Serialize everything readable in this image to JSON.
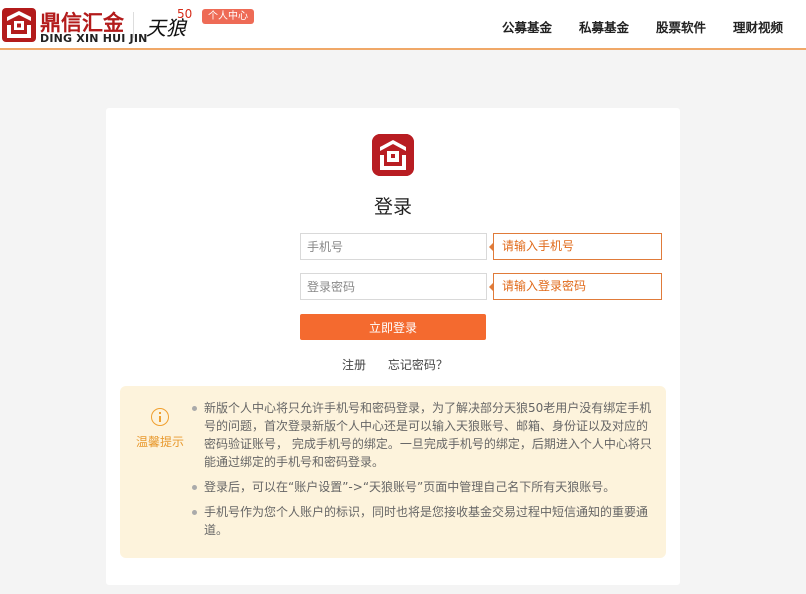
{
  "header": {
    "logo_cn": "鼎信汇金",
    "logo_en": "DING XIN HUI JIN",
    "sub_logo": "天狼",
    "sub_logo_num": "50",
    "badge": "个人中心",
    "nav": [
      "公募基金",
      "私募基金",
      "股票软件",
      "理财视频"
    ]
  },
  "login": {
    "title": "登录",
    "phone_placeholder": "手机号",
    "phone_tip": "请输入手机号",
    "password_placeholder": "登录密码",
    "password_tip": "请输入登录密码",
    "submit_label": "立即登录",
    "register_link": "注册",
    "forgot_link": "忘记密码？"
  },
  "notice": {
    "label": "温馨提示",
    "items": [
      "新版个人中心将只允许手机号和密码登录，为了解决部分天狼50老用户没有绑定手机号的问题，首次登录新版个人中心还是可以输入天狼账号、邮箱、身份证以及对应的密码验证账号， 完成手机号的绑定。一旦完成手机号的绑定，后期进入个人中心将只能通过绑定的手机号和密码登录。",
      "登录后，可以在“账户设置”->“天狼账号”页面中管理自己名下所有天狼账号。",
      "手机号作为您个人账户的标识，同时也将是您接收基金交易过程中短信通知的重要通道。"
    ]
  },
  "colors": {
    "brand_red": "#b31b1b",
    "accent_orange": "#f46a2f",
    "notice_bg": "#fdf3dc"
  }
}
